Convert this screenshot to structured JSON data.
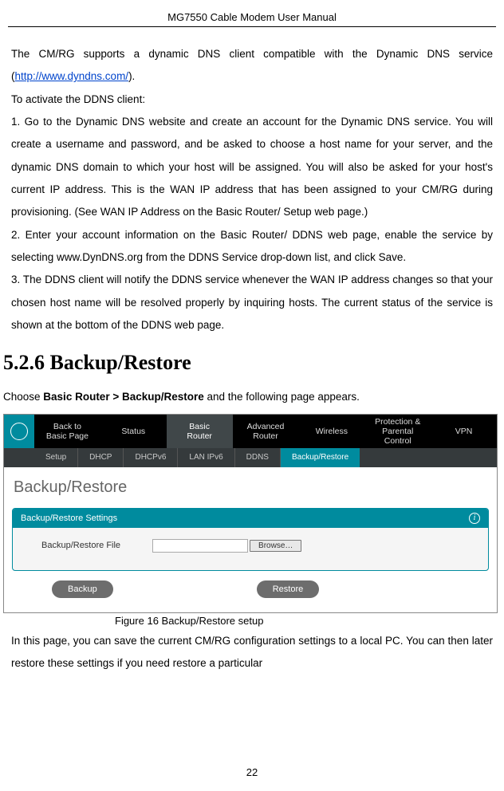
{
  "doc_title": "MG7550 Cable Modem User Manual",
  "para1_part1": "The CM/RG supports a dynamic DNS client compatible with the Dynamic DNS service (",
  "para1_link": "http://www.dyndns.com/",
  "para1_part2": ").",
  "line_activate": "To activate the DDNS client:",
  "step1": "1.  Go to the Dynamic DNS website and create an account for the Dynamic DNS service.   You will create a username and password, and be asked to choose a host name for your server, and the dynamic DNS domain to which your host will be assigned.   You will also be asked for your host's current IP address. This is the WAN IP address that has been assigned to your CM/RG during provisioning. (See WAN IP Address on the Basic Router/ Setup web page.)",
  "step2": "2.  Enter your account information on the Basic Router/ DDNS web page, enable the service by selecting www.DynDNS.org from the DDNS Service drop-down list, and click Save.",
  "step3": "3.  The DDNS client will notify the DDNS service whenever the WAN IP address changes so that your chosen host name will be resolved properly by inquiring hosts. The current status of the service is shown at the bottom of the DDNS web page.",
  "section_heading": "5.2.6   Backup/Restore",
  "choose_text_pre": "Choose ",
  "choose_text_bold": "Basic Router > Backup/Restore",
  "choose_text_post": " and the following page appears.",
  "nav_top": {
    "back": "Back to\nBasic Page",
    "status": "Status",
    "basic": "Basic\nRouter",
    "advanced": "Advanced\nRouter",
    "wireless": "Wireless",
    "protection": "Protection &\nParental Control",
    "vpn": "VPN"
  },
  "nav_sub": {
    "setup": "Setup",
    "dhcp": "DHCP",
    "dhcpv6": "DHCPv6",
    "lanipv6": "LAN IPv6",
    "ddns": "DDNS",
    "backup": "Backup/Restore"
  },
  "panel": {
    "title": "Backup/Restore",
    "settings_header": "Backup/Restore Settings",
    "file_label": "Backup/Restore File",
    "browse": "Browse…",
    "backup_btn": "Backup",
    "restore_btn": "Restore"
  },
  "figure_caption": "Figure 16 Backup/Restore setup",
  "closing_para": "In this page, you can save the current CM/RG configuration settings to a local PC. You can then later restore these settings if you need restore a particular",
  "page_number": "22"
}
